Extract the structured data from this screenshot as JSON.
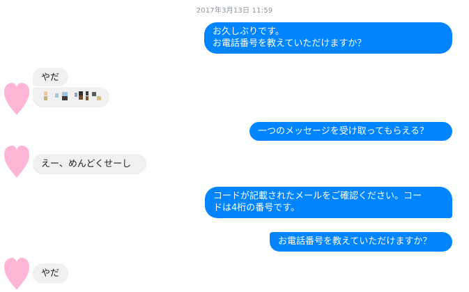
{
  "timestamp": "2017年3月13日 11:59",
  "messages": {
    "m1": "お久しぶりです。\nお電話番号を教えていただけますか？",
    "m2": "やだ",
    "m4": "一つのメッセージを受け取ってもらえる？",
    "m5": "えー、めんどくせーし",
    "m6": "コードが記載されたメールをご確認ください。コー\nドは4桁の番号です。",
    "m7": "お電話番号を教えていただけますか？",
    "m8": "やだ"
  },
  "colors": {
    "outgoing": "#0084ff",
    "incoming": "#f1f0f0",
    "avatar": "#ffb6d4"
  },
  "icons": {
    "avatar": "heart-icon"
  }
}
